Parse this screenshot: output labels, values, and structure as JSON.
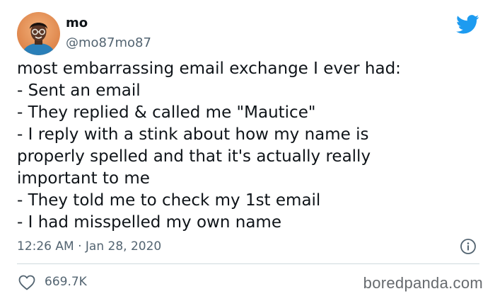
{
  "author": {
    "display_name": "mo",
    "handle": "@mo87mo87",
    "avatar_icon": "profile-photo"
  },
  "brand": {
    "icon": "twitter-bird-icon",
    "color": "#1d9bf0"
  },
  "tweet": {
    "lines": [
      "most embarrassing email exchange I ever had:",
      "- Sent an email",
      "- They replied & called me \"Mautice\"",
      "- I reply with a stink about how my name is",
      "properly spelled and that it's actually really",
      "important to me",
      "- They told me to check my 1st email",
      "- I had misspelled my own name"
    ],
    "timestamp": "12:26 AM · Jan 28, 2020"
  },
  "engagement": {
    "likes": "669.7K",
    "like_icon": "heart-outline-icon",
    "info_icon": "info-circle-icon"
  },
  "watermark": "boredpanda.com",
  "colors": {
    "text": "#0f1419",
    "secondary": "#536471",
    "divider": "#cfd9de"
  }
}
